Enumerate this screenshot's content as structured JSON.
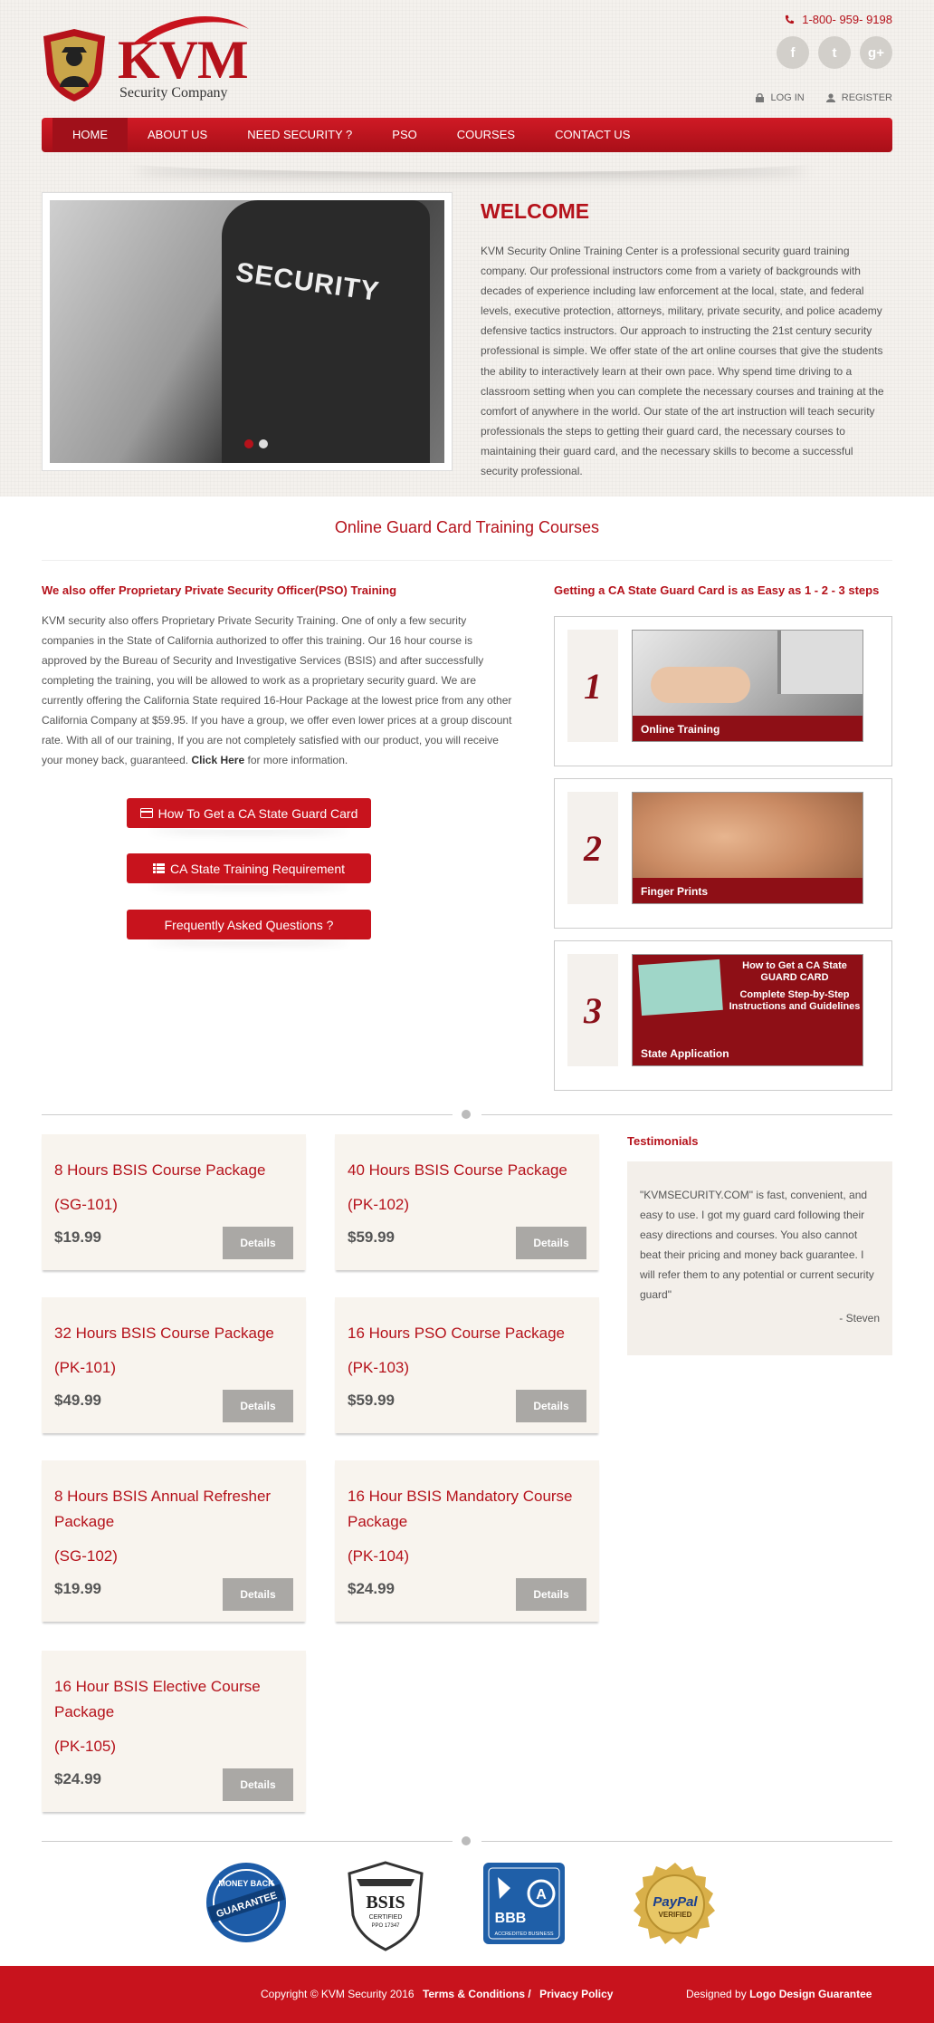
{
  "header": {
    "brand": "KVM",
    "brand_sub": "Security Company",
    "phone": "1-800- 959- 9198",
    "social": [
      "f",
      "t",
      "g+"
    ],
    "login": "LOG IN",
    "register": "REGISTER"
  },
  "nav": [
    "HOME",
    "ABOUT US",
    "NEED SECURITY ?",
    "PSO",
    "COURSES",
    "CONTACT US"
  ],
  "slider": {
    "caption": "SECURITY"
  },
  "welcome": {
    "title": "WELCOME",
    "text": "KVM Security Online Training Center is a professional security guard training company. Our professional instructors come from a variety of backgrounds with decades of experience including law enforcement at the local, state, and federal levels, executive protection, attorneys, military, private security, and police academy defensive tactics instructors. Our approach to instructing the 21st century security professional is simple. We offer state of the art online courses that give the students the ability to interactively learn at their own pace. Why spend time driving to a classroom setting when you can complete the necessary courses and training at the comfort of anywhere in the world. Our state of the art instruction will teach security professionals the steps to getting their guard card, the necessary courses to maintaining their guard card, and the necessary skills to become a successful security professional."
  },
  "section_title": "Online Guard Card Training Courses",
  "pso": {
    "title": "We also offer Proprietary Private Security Officer(PSO) Training",
    "text": "KVM security also offers Proprietary Private Security Training. One of only a few security companies in the State of California authorized to offer this training. Our 16 hour course is approved by the Bureau of Security and Investigative Services (BSIS) and after successfully completing the training, you will be allowed to work as a proprietary security guard. We are currently offering the California State required 16-Hour Package at the lowest price from any other California Company at $59.95. If you have a group, we offer even lower prices at a group discount rate. With all of our training, If you are not completely satisfied with our product, you will receive your money back, guaranteed.",
    "link": "Click Here",
    "after": "for more information.",
    "buttons": [
      "How To Get a CA State Guard Card",
      "CA State Training Requirement",
      "Frequently Asked Questions ?"
    ]
  },
  "steps": {
    "title": "Getting a CA State Guard Card is as Easy as 1 - 2 - 3 steps",
    "items": [
      {
        "num": "1",
        "caption": "Online Training"
      },
      {
        "num": "2",
        "caption": "Finger Prints"
      },
      {
        "num": "3",
        "caption": "State Application",
        "img_line1": "How to Get a CA State",
        "img_line2": "GUARD CARD",
        "img_line3": "Complete Step-by-Step",
        "img_line4": "Instructions and Guidelines"
      }
    ]
  },
  "courses": [
    {
      "name": "8 Hours BSIS Course Package",
      "code": "(SG-101)",
      "price": "$19.99",
      "btn": "Details"
    },
    {
      "name": "40 Hours BSIS Course Package",
      "code": "(PK-102)",
      "price": "$59.99",
      "btn": "Details"
    },
    {
      "name": "32 Hours BSIS Course Package",
      "code": "(PK-101)",
      "price": "$49.99",
      "btn": "Details"
    },
    {
      "name": "16 Hours PSO Course Package",
      "code": "(PK-103)",
      "price": "$59.99",
      "btn": "Details"
    },
    {
      "name": "8 Hours BSIS Annual Refresher Package",
      "code": "(SG-102)",
      "price": "$19.99",
      "btn": "Details"
    },
    {
      "name": "16 Hour BSIS Mandatory Course Package",
      "code": "(PK-104)",
      "price": "$24.99",
      "btn": "Details"
    },
    {
      "name": "16 Hour BSIS Elective Course Package",
      "code": "(PK-105)",
      "price": "$24.99",
      "btn": "Details"
    }
  ],
  "testimonials": {
    "title": "Testimonials",
    "quote": "\"KVMSECURITY.COM\" is fast, convenient, and easy to use. I got my guard card following their easy directions and courses. You also cannot beat their pricing and money back guarantee. I will refer them to any potential or current security guard\"",
    "author": "- Steven"
  },
  "badges": {
    "money_top": "MONEY BACK",
    "money_mid": "GUARANTEE",
    "bsis": "BSIS",
    "bsis_sub": "CERTIFIED",
    "bsis_no": "PPO 17347",
    "bbb": "BBB",
    "bbb_sub": "ACCREDITED BUSINESS",
    "paypal": "PayPal",
    "paypal_sub": "VERIFIED"
  },
  "footer": {
    "copyright": "Copyright © KVM Security 2016",
    "terms": "Terms & Conditions /",
    "privacy": "Privacy Policy",
    "designed": "Designed by",
    "designer": "Logo Design Guarantee"
  },
  "colors": {
    "brand": "#b5121b",
    "nav": "#c8131d",
    "footer": "#c8131d"
  }
}
